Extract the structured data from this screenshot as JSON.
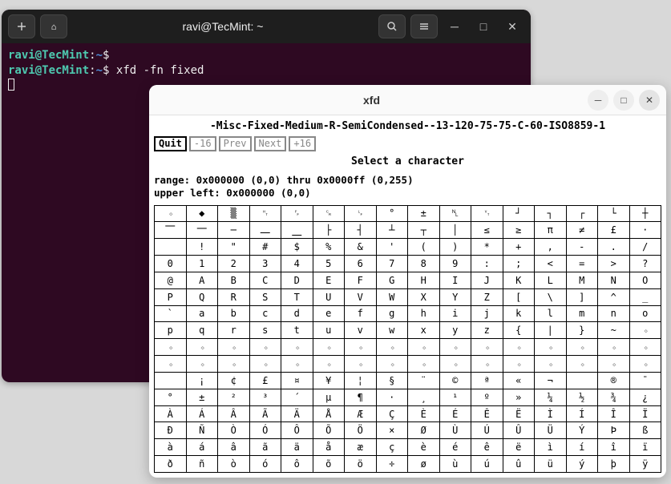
{
  "terminal": {
    "title": "ravi@TecMint: ~",
    "prompt_user": "ravi@TecMint",
    "prompt_path": "~",
    "lines": [
      {
        "cmd": ""
      },
      {
        "cmd": "xfd -fn fixed"
      }
    ]
  },
  "xfd": {
    "title": "xfd",
    "font_name": "-Misc-Fixed-Medium-R-SemiCondensed--13-120-75-75-C-60-ISO8859-1",
    "buttons": {
      "quit": "Quit",
      "prev16": "-16",
      "prev": "Prev",
      "next": "Next",
      "next16": "+16"
    },
    "select_label": "Select a character",
    "range_line": "range:  0x000000 (0,0) thru 0x0000ff (0,255)",
    "upper_left_line": "upper left:  0x000000 (0,0)",
    "grid": [
      [
        "⋄",
        "◆",
        "▒",
        "␉",
        "␌",
        "␍",
        "␊",
        "°",
        "±",
        "␤",
        "␋",
        "┘",
        "┐",
        "┌",
        "└",
        "┼"
      ],
      [
        "⎺",
        "⎻",
        "─",
        "⎼",
        "⎽",
        "├",
        "┤",
        "┴",
        "┬",
        "│",
        "≤",
        "≥",
        "π",
        "≠",
        "£",
        "·"
      ],
      [
        " ",
        "!",
        "\"",
        "#",
        "$",
        "%",
        "&",
        "'",
        "(",
        ")",
        "*",
        "+",
        ",",
        "-",
        ".",
        "/"
      ],
      [
        "0",
        "1",
        "2",
        "3",
        "4",
        "5",
        "6",
        "7",
        "8",
        "9",
        ":",
        ";",
        "<",
        "=",
        ">",
        "?"
      ],
      [
        "@",
        "A",
        "B",
        "C",
        "D",
        "E",
        "F",
        "G",
        "H",
        "I",
        "J",
        "K",
        "L",
        "M",
        "N",
        "O"
      ],
      [
        "P",
        "Q",
        "R",
        "S",
        "T",
        "U",
        "V",
        "W",
        "X",
        "Y",
        "Z",
        "[",
        "\\",
        "]",
        "^",
        "_"
      ],
      [
        "`",
        "a",
        "b",
        "c",
        "d",
        "e",
        "f",
        "g",
        "h",
        "i",
        "j",
        "k",
        "l",
        "m",
        "n",
        "o"
      ],
      [
        "p",
        "q",
        "r",
        "s",
        "t",
        "u",
        "v",
        "w",
        "x",
        "y",
        "z",
        "{",
        "|",
        "}",
        "~",
        "⋄"
      ],
      [
        "⋄",
        "⋄",
        "⋄",
        "⋄",
        "⋄",
        "⋄",
        "⋄",
        "⋄",
        "⋄",
        "⋄",
        "⋄",
        "⋄",
        "⋄",
        "⋄",
        "⋄",
        "⋄"
      ],
      [
        "⋄",
        "⋄",
        "⋄",
        "⋄",
        "⋄",
        "⋄",
        "⋄",
        "⋄",
        "⋄",
        "⋄",
        "⋄",
        "⋄",
        "⋄",
        "⋄",
        "⋄",
        "⋄"
      ],
      [
        " ",
        "¡",
        "¢",
        "£",
        "¤",
        "¥",
        "¦",
        "§",
        "¨",
        "©",
        "ª",
        "«",
        "¬",
        "­",
        "®",
        "¯"
      ],
      [
        "°",
        "±",
        "²",
        "³",
        "´",
        "µ",
        "¶",
        "·",
        "¸",
        "¹",
        "º",
        "»",
        "¼",
        "½",
        "¾",
        "¿"
      ],
      [
        "À",
        "Á",
        "Â",
        "Ã",
        "Ä",
        "Å",
        "Æ",
        "Ç",
        "È",
        "É",
        "Ê",
        "Ë",
        "Ì",
        "Í",
        "Î",
        "Ï"
      ],
      [
        "Ð",
        "Ñ",
        "Ò",
        "Ó",
        "Ô",
        "Õ",
        "Ö",
        "×",
        "Ø",
        "Ù",
        "Ú",
        "Û",
        "Ü",
        "Ý",
        "Þ",
        "ß"
      ],
      [
        "à",
        "á",
        "â",
        "ã",
        "ä",
        "å",
        "æ",
        "ç",
        "è",
        "é",
        "ê",
        "ë",
        "ì",
        "í",
        "î",
        "ï"
      ],
      [
        "ð",
        "ñ",
        "ò",
        "ó",
        "ô",
        "õ",
        "ö",
        "÷",
        "ø",
        "ù",
        "ú",
        "û",
        "ü",
        "ý",
        "þ",
        "ÿ"
      ]
    ]
  }
}
